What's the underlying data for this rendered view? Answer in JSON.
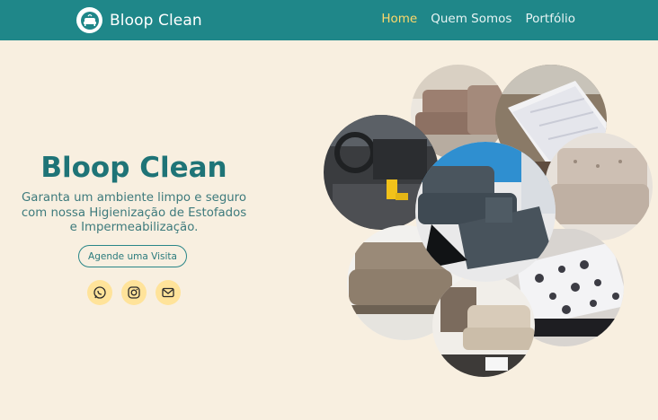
{
  "header": {
    "brand_name": "Bloop Clean",
    "nav": [
      {
        "label": "Home",
        "active": true
      },
      {
        "label": "Quem Somos",
        "active": false
      },
      {
        "label": "Portfólio",
        "active": false
      }
    ]
  },
  "hero": {
    "title": "Bloop Clean",
    "subtitle": "Garanta um ambiente limpo e seguro com nossa Higienização de Estofados e Impermeabilização.",
    "cta_label": "Agende uma Visita",
    "socials": [
      "whatsapp-icon",
      "instagram-icon",
      "mail-icon"
    ]
  },
  "colors": {
    "header_bg": "#1f8789",
    "page_bg": "#f8efe0",
    "accent_active": "#ffd86a",
    "title": "#1f7477",
    "social_bg": "#ffe39a"
  },
  "gallery": {
    "photos": [
      "sofa-brown-corner-photo",
      "mattress-white-photo",
      "car-interior-photo",
      "sofa-gray-chaise-photo",
      "sofa-beige-tufted-photo",
      "sofa-taupe-living-room-photo",
      "mattress-floral-photo",
      "sofa-cream-corner-photo"
    ]
  }
}
